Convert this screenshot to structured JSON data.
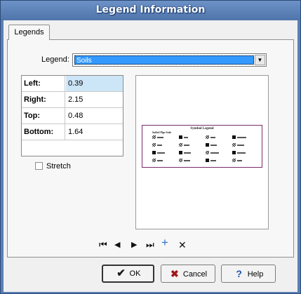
{
  "window": {
    "title": "Legend Information"
  },
  "tabs": [
    {
      "label": "Legends"
    }
  ],
  "legend": {
    "label": "Legend:",
    "selected_value": "Soils"
  },
  "margins": [
    {
      "label": "Left:",
      "value": "0.39"
    },
    {
      "label": "Right:",
      "value": "2.15"
    },
    {
      "label": "Top:",
      "value": "0.48"
    },
    {
      "label": "Bottom:",
      "value": "1.64"
    }
  ],
  "stretch": {
    "label": "Stretch",
    "checked": false
  },
  "preview": {
    "title": "Symbol Legend",
    "subtitle": "Soiled Pipe Info"
  },
  "navigator": {
    "first": "⏮",
    "prev": "◀",
    "next": "▶",
    "last": "⏭",
    "add": "+",
    "delete": "✕"
  },
  "buttons": {
    "ok": "OK",
    "cancel": "Cancel",
    "help": "Help"
  },
  "icons": {
    "ok": "checkmark-icon",
    "cancel": "cancel-x-icon",
    "help": "help-question-icon"
  },
  "colors": {
    "titlebar": "#5a7fb5",
    "selection": "#3399ff",
    "preview_border": "#7a2a6a"
  }
}
